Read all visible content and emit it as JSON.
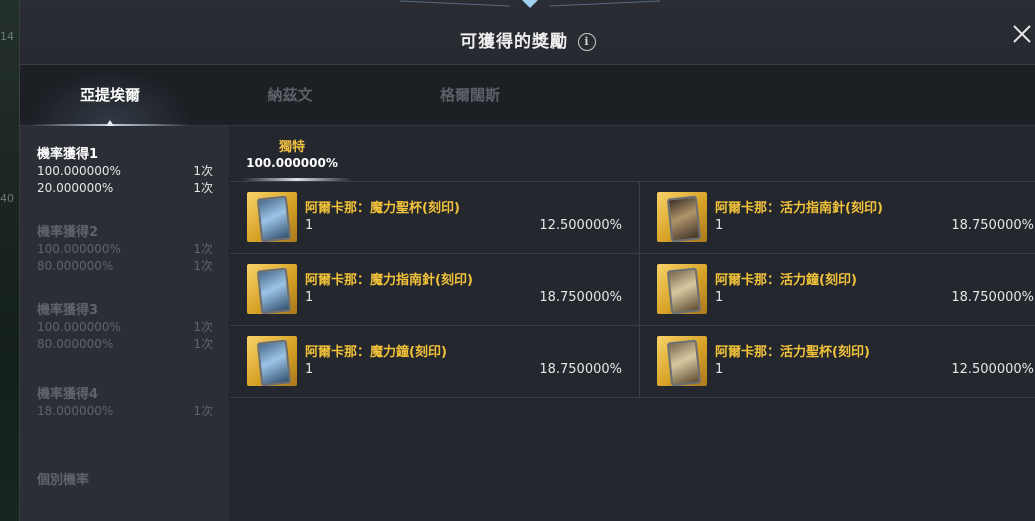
{
  "window": {
    "title": "可獲得的獎勵",
    "info_icon": "info-icon",
    "close_icon": "close-icon"
  },
  "background": {
    "numbers": [
      "14",
      "40"
    ]
  },
  "tabs": [
    {
      "label": "亞提埃爾",
      "active": true
    },
    {
      "label": "納茲文",
      "active": false
    },
    {
      "label": "格爾闊斯",
      "active": false
    }
  ],
  "sidebar": {
    "groups": [
      {
        "title": "機率獲得1",
        "active": true,
        "rows": [
          {
            "pct": "100.000000%",
            "count": "1次"
          },
          {
            "pct": "20.000000%",
            "count": "1次"
          }
        ]
      },
      {
        "title": "機率獲得2",
        "active": false,
        "rows": [
          {
            "pct": "100.000000%",
            "count": "1次"
          },
          {
            "pct": "80.000000%",
            "count": "1次"
          }
        ]
      },
      {
        "title": "機率獲得3",
        "active": false,
        "rows": [
          {
            "pct": "100.000000%",
            "count": "1次"
          },
          {
            "pct": "80.000000%",
            "count": "1次"
          }
        ]
      },
      {
        "title": "機率獲得4",
        "active": false,
        "rows": [
          {
            "pct": "18.000000%",
            "count": "1次"
          }
        ]
      }
    ],
    "individual": "個別機率"
  },
  "subtab": {
    "name": "獨特",
    "pct": "100.000000%"
  },
  "items": [
    {
      "name": "阿爾卡那：魔力聖杯(刻印)",
      "qty": "1",
      "pct": "12.500000%",
      "icon": "arcana-card-blue-icon"
    },
    {
      "name": "阿爾卡那：活力指南針(刻印)",
      "qty": "1",
      "pct": "18.750000%",
      "icon": "arcana-card-gold-icon"
    },
    {
      "name": "阿爾卡那：魔力指南針(刻印)",
      "qty": "1",
      "pct": "18.750000%",
      "icon": "arcana-card-blue-icon"
    },
    {
      "name": "阿爾卡那：活力鐘(刻印)",
      "qty": "1",
      "pct": "18.750000%",
      "icon": "arcana-card-gold-icon"
    },
    {
      "name": "阿爾卡那：魔力鐘(刻印)",
      "qty": "1",
      "pct": "18.750000%",
      "icon": "arcana-card-blue-icon"
    },
    {
      "name": "阿爾卡那：活力聖杯(刻印)",
      "qty": "1",
      "pct": "12.500000%",
      "icon": "arcana-card-gold-icon"
    }
  ],
  "colors": {
    "accent_gold": "#f2c23a",
    "window_bg": "#21242a",
    "sidebar_bg": "#2b2e34"
  }
}
